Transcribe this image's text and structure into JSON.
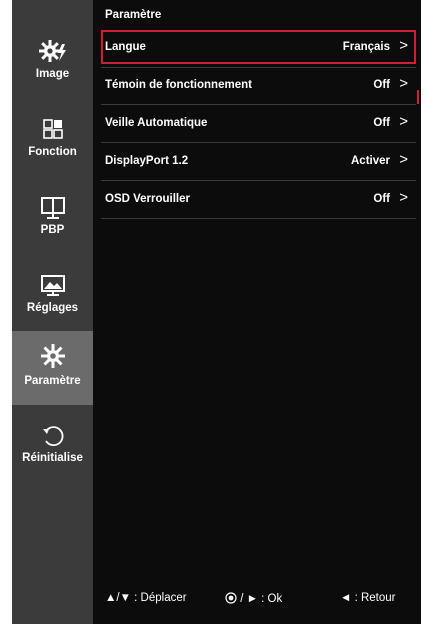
{
  "sidebar": {
    "items": [
      {
        "label": "Image",
        "icon": "picture-gear-icon"
      },
      {
        "label": "Fonction",
        "icon": "function-grid-icon"
      },
      {
        "label": "PBP",
        "icon": "pbp-monitor-icon"
      },
      {
        "label": "Réglages",
        "icon": "landscape-adjust-icon"
      },
      {
        "label": "Paramètre",
        "icon": "gear-icon",
        "active": true
      },
      {
        "label": "Réinitialise",
        "icon": "reset-icon"
      }
    ]
  },
  "main": {
    "title": "Paramètre",
    "rows": [
      {
        "label": "Langue",
        "value": "Français",
        "chevron": ">"
      },
      {
        "label": "Témoin de fonctionnement",
        "value": "Off",
        "chevron": ">"
      },
      {
        "label": "Veille Automatique",
        "value": "Off",
        "chevron": ">"
      },
      {
        "label": "DisplayPort 1.2",
        "value": "Activer",
        "chevron": ">"
      },
      {
        "label": "OSD Verrouiller",
        "value": "Off",
        "chevron": ">"
      }
    ]
  },
  "footer": {
    "move": "▲/▼ : Déplacer",
    "ok": "/ ► : Ok",
    "back": "◄ : Retour"
  },
  "colors": {
    "accent": "#d21f2b",
    "sidebar_bg": "#3b3b3b",
    "sidebar_active": "#6b6b6b",
    "panel_bg": "#0c0c0c"
  }
}
